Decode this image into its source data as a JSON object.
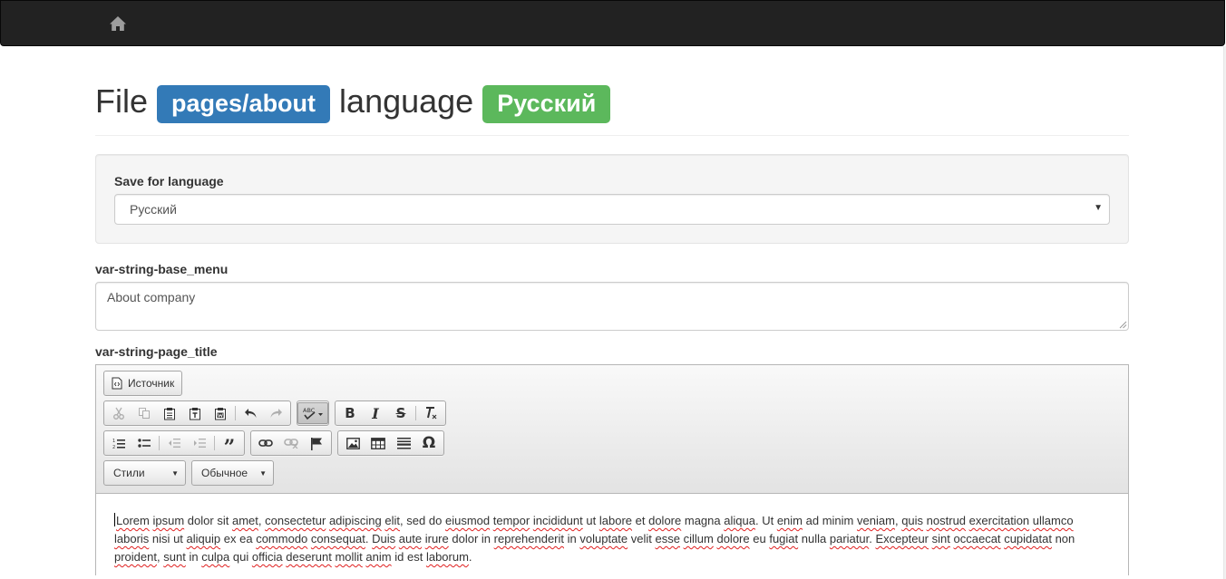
{
  "nav": {
    "home_icon": "home-icon"
  },
  "header": {
    "word_file": "File",
    "file_badge": "pages/about",
    "word_language": "language",
    "language_badge": "Русский"
  },
  "save_for_language": {
    "label": "Save for language",
    "selected": "Русский"
  },
  "fields": {
    "base_menu": {
      "label": "var-string-base_menu",
      "value": "About company"
    },
    "page_title": {
      "label": "var-string-page_title"
    }
  },
  "editor": {
    "source_button": "Источник",
    "styles_combo": "Стили",
    "format_combo": "Обычное",
    "toolbar_icons": [
      "cut-icon",
      "copy-icon",
      "paste-icon",
      "paste-text-icon",
      "paste-word-icon",
      "undo-icon",
      "redo-icon",
      "spellcheck-icon",
      "bold-icon",
      "italic-icon",
      "strike-icon",
      "remove-format-icon",
      "numbered-list-icon",
      "bulleted-list-icon",
      "outdent-icon",
      "indent-icon",
      "blockquote-icon",
      "link-icon",
      "unlink-icon",
      "anchor-icon",
      "image-icon",
      "table-icon",
      "horizontal-rule-icon",
      "special-char-icon"
    ],
    "body_text": "Lorem ipsum dolor sit amet, consectetur adipiscing elit, sed do eiusmod tempor incididunt ut labore et dolore magna aliqua. Ut enim ad minim veniam, quis nostrud exercitation ullamco laboris nisi ut aliquip ex ea commodo consequat. Duis aute irure dolor in reprehenderit in voluptate velit esse cillum dolore eu fugiat nulla pariatur. Excepteur sint occaecat cupidatat non proident, sunt in culpa qui officia deserunt mollit anim id est laborum."
  },
  "colors": {
    "navbar": "#222222",
    "primary_badge": "#337ab7",
    "success_badge": "#5cb85c",
    "spell_underline": "#e02020"
  }
}
